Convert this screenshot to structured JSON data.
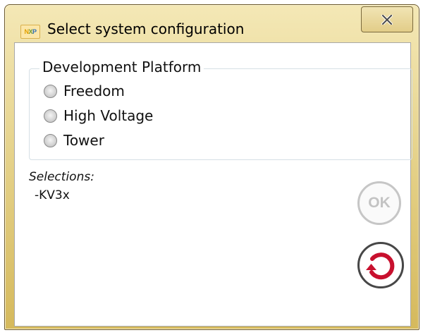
{
  "window": {
    "title": "Select system configuration",
    "app_icon": {
      "name": "nxp-logo-icon",
      "letters": [
        "N",
        "X",
        "P"
      ]
    },
    "close_icon": "close-icon"
  },
  "platform_group": {
    "legend": "Development Platform",
    "options": [
      {
        "label": "Freedom",
        "selected": false
      },
      {
        "label": "High Voltage",
        "selected": false
      },
      {
        "label": "Tower",
        "selected": false
      }
    ]
  },
  "selections": {
    "label": "Selections:",
    "items": [
      "-KV3x"
    ]
  },
  "buttons": {
    "ok_label": "OK",
    "ok_enabled": false,
    "reset_icon": "reset-icon"
  },
  "colors": {
    "title_bar": "#e6d38c",
    "reset_arrow": "#c8102e",
    "disabled_text": "#c3c3c3"
  }
}
